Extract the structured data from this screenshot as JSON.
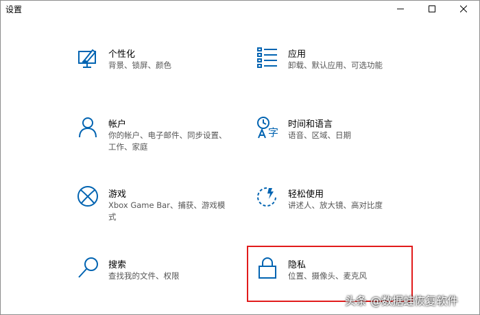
{
  "window": {
    "title": "设置"
  },
  "items": [
    {
      "name": "个性化",
      "desc": "背景、锁屏、颜色",
      "icon": "personalization-icon"
    },
    {
      "name": "应用",
      "desc": "卸载、默认应用、可选功能",
      "icon": "apps-icon"
    },
    {
      "name": "帐户",
      "desc": "你的帐户、电子邮件、同步设置、工作、家庭",
      "icon": "accounts-icon"
    },
    {
      "name": "时间和语言",
      "desc": "语音、区域、日期",
      "icon": "time-language-icon"
    },
    {
      "name": "游戏",
      "desc": "Xbox Game Bar、捕获、游戏模式",
      "icon": "gaming-icon"
    },
    {
      "name": "轻松使用",
      "desc": "讲述人、放大镜、高对比度",
      "icon": "ease-of-access-icon"
    },
    {
      "name": "搜索",
      "desc": "查找我的文件、权限",
      "icon": "search-icon"
    },
    {
      "name": "隐私",
      "desc": "位置、摄像头、麦克风",
      "icon": "lock-icon"
    }
  ],
  "watermark": "头条 @数据蛙恢复软件",
  "colors": {
    "accent": "#0063b1",
    "highlight": "#e11a1a"
  }
}
